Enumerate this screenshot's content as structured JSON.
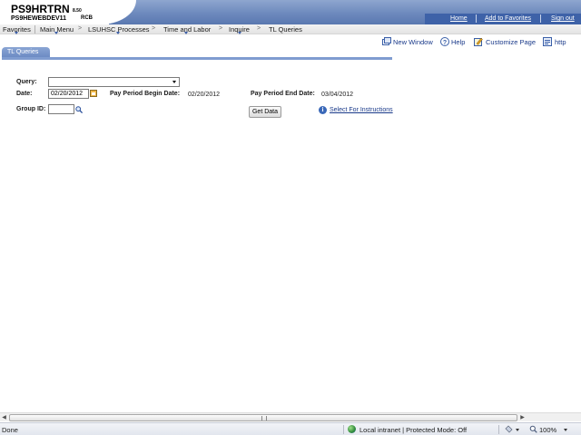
{
  "header": {
    "app_title": "PS9HRTRN",
    "version": "8.50",
    "database": "PS9HEWEBDEV11",
    "user": "RCB",
    "links": [
      "Home",
      "Add to Favorites",
      "Sign out"
    ]
  },
  "menubar": {
    "items": [
      "Favorites",
      "Main Menu",
      "LSUHSC Processes",
      "Time and Labor",
      "Inquire",
      "TL Queries"
    ],
    "separator": ">"
  },
  "pagebar": {
    "new_window": "New Window",
    "help": "Help",
    "customize_page": "Customize Page",
    "http": "http"
  },
  "tab": {
    "label": "TL Queries"
  },
  "form": {
    "query_label": "Query:",
    "query_value": "",
    "date_label": "Date:",
    "date_value": "02/20/2012",
    "begin_label": "Pay Period Begin Date:",
    "begin_value": "02/20/2012",
    "end_label": "Pay Period End Date:",
    "end_value": "03/04/2012",
    "group_label": "Group ID:",
    "group_value": "",
    "get_data": "Get Data",
    "instructions_link": "Select For Instructions"
  },
  "statusbar": {
    "left_text": "Done",
    "zone_text": "Local intranet | Protected Mode: Off",
    "zoom": "100%"
  },
  "icons": {
    "info": "i"
  }
}
